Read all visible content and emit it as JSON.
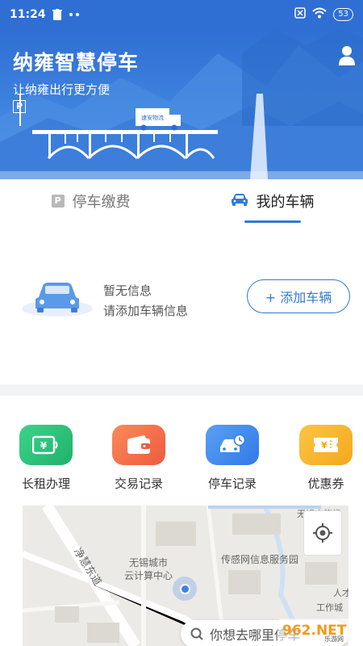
{
  "status_bar": {
    "time": "11:24",
    "battery": "53"
  },
  "banner": {
    "title": "纳雍智慧停车",
    "subtitle": "让纳雍出行更方便",
    "parking_sign": "P",
    "truck_text": "速安物流"
  },
  "tabs": [
    {
      "label": "停车缴费",
      "icon": "parking-icon",
      "active": false
    },
    {
      "label": "我的车辆",
      "icon": "car-icon",
      "active": true
    }
  ],
  "vehicle": {
    "empty_title": "暂无信息",
    "empty_hint": "请添加车辆信息",
    "add_button": "+ 添加车辆"
  },
  "actions": [
    {
      "label": "长租办理",
      "icon": "long-term-rental-icon",
      "color": "#2bc178"
    },
    {
      "label": "交易记录",
      "icon": "wallet-icon",
      "color": "#f36b4b"
    },
    {
      "label": "停车记录",
      "icon": "parking-record-icon",
      "color": "#3d86ee"
    },
    {
      "label": "优惠券",
      "icon": "coupon-icon",
      "color": "#f8b82b"
    }
  ],
  "map": {
    "labels": [
      "无锡高等级",
      "净慧东道",
      "无锡城市",
      "云计算中心",
      "传感网信息服务园",
      "人才",
      "工作城"
    ],
    "search_placeholder": "你想去哪里停车"
  },
  "watermark": {
    "text": "962.NET",
    "sub": "乐游网"
  },
  "colors": {
    "primary": "#2f7ad8",
    "banner": "#2f6fd3"
  }
}
